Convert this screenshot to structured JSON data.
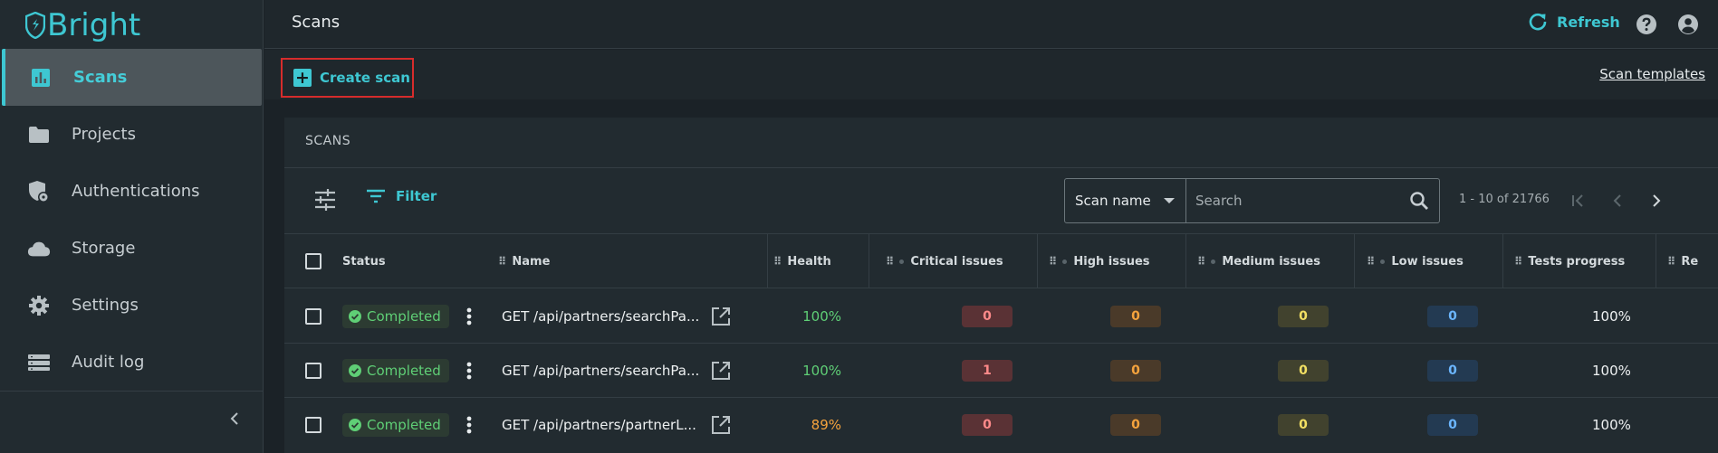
{
  "brand": {
    "name": "Bright",
    "accent": "#3ec7d2"
  },
  "sidebar": {
    "items": [
      {
        "label": "Scans",
        "icon": "bar-chart-icon",
        "active": true
      },
      {
        "label": "Projects",
        "icon": "folder-icon",
        "active": false
      },
      {
        "label": "Authentications",
        "icon": "shield-lock-icon",
        "active": false
      },
      {
        "label": "Storage",
        "icon": "cloud-icon",
        "active": false
      },
      {
        "label": "Settings",
        "icon": "gear-icon",
        "active": false
      },
      {
        "label": "Audit log",
        "icon": "list-icon",
        "active": false
      }
    ]
  },
  "header": {
    "title": "Scans",
    "refresh_label": "Refresh"
  },
  "toolbar": {
    "create_label": "Create scan",
    "templates_label": "Scan templates"
  },
  "card": {
    "title": "SCANS",
    "filter_label": "Filter",
    "search_field": "Scan name",
    "search_placeholder": "Search",
    "pagination": "1 - 10 of 21766"
  },
  "table": {
    "columns": {
      "status": "Status",
      "name": "Name",
      "health": "Health",
      "critical": "Critical issues",
      "high": "High issues",
      "medium": "Medium issues",
      "low": "Low issues",
      "progress": "Tests progress",
      "requests": "Re"
    },
    "rows": [
      {
        "status": "Completed",
        "name": "GET /api/partners/searchPa...",
        "health": "100%",
        "health_color": "#5fcf76",
        "critical": "0",
        "high": "0",
        "medium": "0",
        "low": "0",
        "progress": "100%"
      },
      {
        "status": "Completed",
        "name": "GET /api/partners/searchPa...",
        "health": "100%",
        "health_color": "#5fcf76",
        "critical": "1",
        "high": "0",
        "medium": "0",
        "low": "0",
        "progress": "100%"
      },
      {
        "status": "Completed",
        "name": "GET /api/partners/partnerL...",
        "health": "89%",
        "health_color": "#f5a33d",
        "critical": "0",
        "high": "0",
        "medium": "0",
        "low": "0",
        "progress": "100%"
      }
    ]
  }
}
